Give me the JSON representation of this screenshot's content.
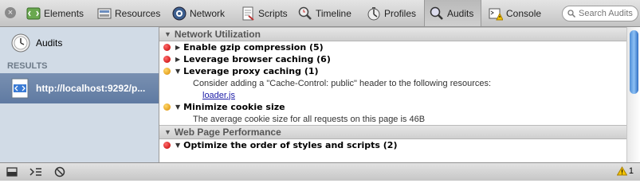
{
  "toolbar": {
    "tabs": [
      {
        "label": "Elements",
        "icon": "elements-icon"
      },
      {
        "label": "Resources",
        "icon": "resources-icon"
      },
      {
        "label": "Network",
        "icon": "network-icon"
      },
      {
        "label": "Scripts",
        "icon": "scripts-icon"
      },
      {
        "label": "Timeline",
        "icon": "timeline-icon"
      },
      {
        "label": "Profiles",
        "icon": "profiles-icon"
      },
      {
        "label": "Audits",
        "icon": "audits-icon",
        "selected": true
      },
      {
        "label": "Console",
        "icon": "console-icon"
      }
    ],
    "search_placeholder": "Search Audits"
  },
  "sidebar": {
    "audits_label": "Audits",
    "results_heading": "RESULTS",
    "result_item": "http://localhost:9292/p..."
  },
  "main": {
    "categories": [
      {
        "title": "Network Utilization",
        "rules": [
          {
            "severity": "red",
            "expanded": false,
            "title": "Enable gzip compression (5)"
          },
          {
            "severity": "red",
            "expanded": false,
            "title": "Leverage browser caching (6)"
          },
          {
            "severity": "yellow",
            "expanded": true,
            "title": "Leverage proxy caching (1)",
            "detail": "Consider adding a \"Cache-Control: public\" header to the following resources:",
            "link": "loader.js"
          },
          {
            "severity": "yellow",
            "expanded": true,
            "title": "Minimize cookie size",
            "detail": "The average cookie size for all requests on this page is 46B"
          }
        ]
      },
      {
        "title": "Web Page Performance",
        "rules": [
          {
            "severity": "red",
            "expanded": true,
            "title": "Optimize the order of styles and scripts (2)"
          }
        ]
      }
    ]
  },
  "statusbar": {
    "warning_count": "1"
  },
  "colors": {
    "error": "#c10000",
    "warning": "#d98a00",
    "selection": "#6a84aa",
    "link": "#1a1aa6"
  }
}
